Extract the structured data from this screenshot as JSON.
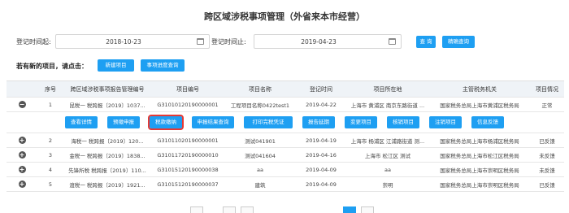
{
  "page": {
    "title": "跨区域涉税事项管理（外省来本市经营）"
  },
  "filters": {
    "from_label": "登记时间起:",
    "from_value": "2018-10-23",
    "to_label": "登记时间止:",
    "to_value": "2019-04-23",
    "query_label": "查 询",
    "precise_query_label": "精确查询"
  },
  "new_project": {
    "prompt": "若有新的项目，请点击：",
    "new_button": "新建项目",
    "progress_button": "事项进度查询"
  },
  "table": {
    "headers": [
      "序号",
      "跨区域涉税事项报告管理编号",
      "项目编号",
      "项目名称",
      "登记时间",
      "项目所在地",
      "主管税务机关",
      "项目情况"
    ],
    "rows": [
      {
        "index": "1",
        "report_no": "昆税一 税跨报〔2019〕1037...",
        "project_no": "G31010120190000001",
        "project_name": "工程项目名称0422test1",
        "reg_time": "2019-04-22",
        "location": "上海市 黄浦区 南京东路街道 ...",
        "authority": "国家税务总局上海市黄浦区税务局",
        "status": "正常"
      },
      {
        "index": "2",
        "report_no": "海税一 税跨报〔2019〕120...",
        "project_no": "G31011020190000001",
        "project_name": "测试041901",
        "reg_time": "2019-04-19",
        "location": "上海市 杨浦区 江浦路街道 测...",
        "authority": "国家税务总局上海市杨浦区税务局",
        "status": "已反馈"
      },
      {
        "index": "3",
        "report_no": "金税一 税跨报〔2019〕1838...",
        "project_no": "G31011720190000010",
        "project_name": "测试041604",
        "reg_time": "2019-04-16",
        "location": "上海市 松江区 测试",
        "authority": "国家税务总局上海市松江区税务局",
        "status": "未反馈"
      },
      {
        "index": "4",
        "report_no": "先锋所税 税跨报〔2019〕110...",
        "project_no": "G31015120190000038",
        "project_name": "aa",
        "reg_time": "2019-04-09",
        "location": "aa",
        "authority": "国家税务总局上海市崇明区税务局",
        "status": "未反馈"
      },
      {
        "index": "5",
        "report_no": "渡税一 税跨报〔2019〕1921...",
        "project_no": "G31015120190000037",
        "project_name": "建筑",
        "reg_time": "2019-04-09",
        "location": "崇明",
        "authority": "国家税务总局上海市崇明区税务局",
        "status": "已反馈"
      }
    ],
    "actions": [
      "查看详情",
      "预缴申报",
      "税款缴纳",
      "申报结果查询",
      "打印完税凭证",
      "报告延期",
      "变更项目",
      "核销项目",
      "注销项目",
      "信息反馈"
    ]
  },
  "colors": {
    "accent": "#1e9ff2",
    "highlight": "#e53935",
    "header_bg": "#eff3f7"
  }
}
